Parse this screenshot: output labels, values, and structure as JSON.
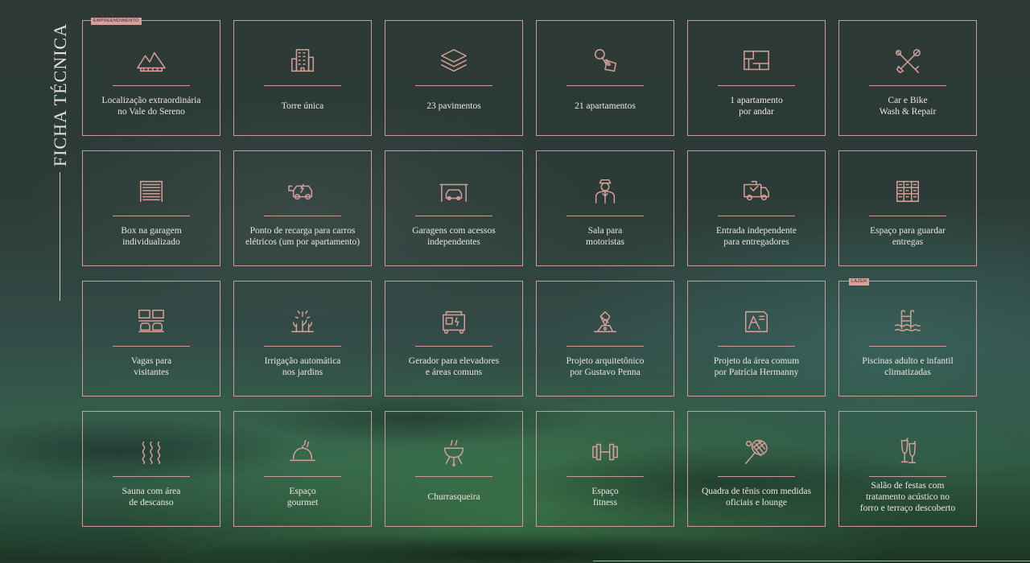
{
  "side_title": "FICHA TÉCNICA",
  "colors": {
    "accent": "#d59d97",
    "text": "#ece6e2",
    "background": "#2d3a36"
  },
  "cards": [
    {
      "icon": "mountain-icon",
      "label": "Localização extraordinária\nno Vale do Sereno",
      "tag": "EMPREENDIMENTO"
    },
    {
      "icon": "building-icon",
      "label": "Torre única"
    },
    {
      "icon": "layers-icon",
      "label": "23 pavimentos"
    },
    {
      "icon": "key-tag-icon",
      "label": "21 apartamentos"
    },
    {
      "icon": "floor-plan-icon",
      "label": "1 apartamento\npor andar"
    },
    {
      "icon": "tools-icon",
      "label": "Car e Bike\nWash & Repair"
    },
    {
      "icon": "garage-door-icon",
      "label": "Box na garagem\nindividualizado"
    },
    {
      "icon": "electric-car-icon",
      "label": "Ponto de recarga para carros\nelétricos (um por apartamento)"
    },
    {
      "icon": "garage-car-icon",
      "label": "Garagens com acessos\nindependentes"
    },
    {
      "icon": "chauffeur-icon",
      "label": "Sala para\nmotoristas"
    },
    {
      "icon": "delivery-truck-icon",
      "label": "Entrada independente\npara entregadores"
    },
    {
      "icon": "lockers-icon",
      "label": "Espaço para guardar\nentregas"
    },
    {
      "icon": "parking-cars-icon",
      "label": "Vagas para\nvisitantes"
    },
    {
      "icon": "irrigation-icon",
      "label": "Irrigação automática\nnos jardins"
    },
    {
      "icon": "generator-icon",
      "label": "Gerador para elevadores\ne áreas comuns"
    },
    {
      "icon": "architect-icon",
      "label": "Projeto arquitetônico\npor Gustavo Penna"
    },
    {
      "icon": "blueprint-icon",
      "label": "Projeto da área comum\npor Patrícia Hermanny"
    },
    {
      "icon": "pool-icon",
      "label": "Piscinas adulto e infantil\nclimatizadas",
      "tag": "LAZER"
    },
    {
      "icon": "steam-icon",
      "label": "Sauna com área\nde descanso"
    },
    {
      "icon": "cloche-icon",
      "label": "Espaço\ngourmet"
    },
    {
      "icon": "grill-icon",
      "label": "Churrasqueira"
    },
    {
      "icon": "dumbbell-icon",
      "label": "Espaço\nfitness"
    },
    {
      "icon": "tennis-racket-icon",
      "label": "Quadra de tênis com medidas\noficiais e lounge"
    },
    {
      "icon": "champagne-icon",
      "label": "Salão de festas com\ntratamento acústico no\nforro e terraço descoberto"
    }
  ]
}
